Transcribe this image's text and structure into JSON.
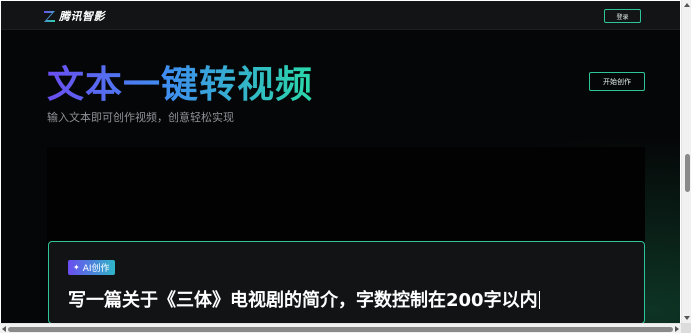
{
  "header": {
    "brand_name": "腾讯智影",
    "login_label": "登录"
  },
  "hero": {
    "title": "文本一键转视频",
    "subtitle": "输入文本即可创作视频，创意轻松实现",
    "start_label": "开始创作"
  },
  "prompt_card": {
    "badge_label": "AI创作",
    "badge_icon": "sparkle-icon",
    "text": "写一篇关于《三体》电视剧的简介，字数控制在200字以内"
  },
  "colors": {
    "accent": "#2fc59a",
    "gradient_start": "#6a4ef0",
    "gradient_end": "#2ad8a8",
    "background": "#050607"
  }
}
